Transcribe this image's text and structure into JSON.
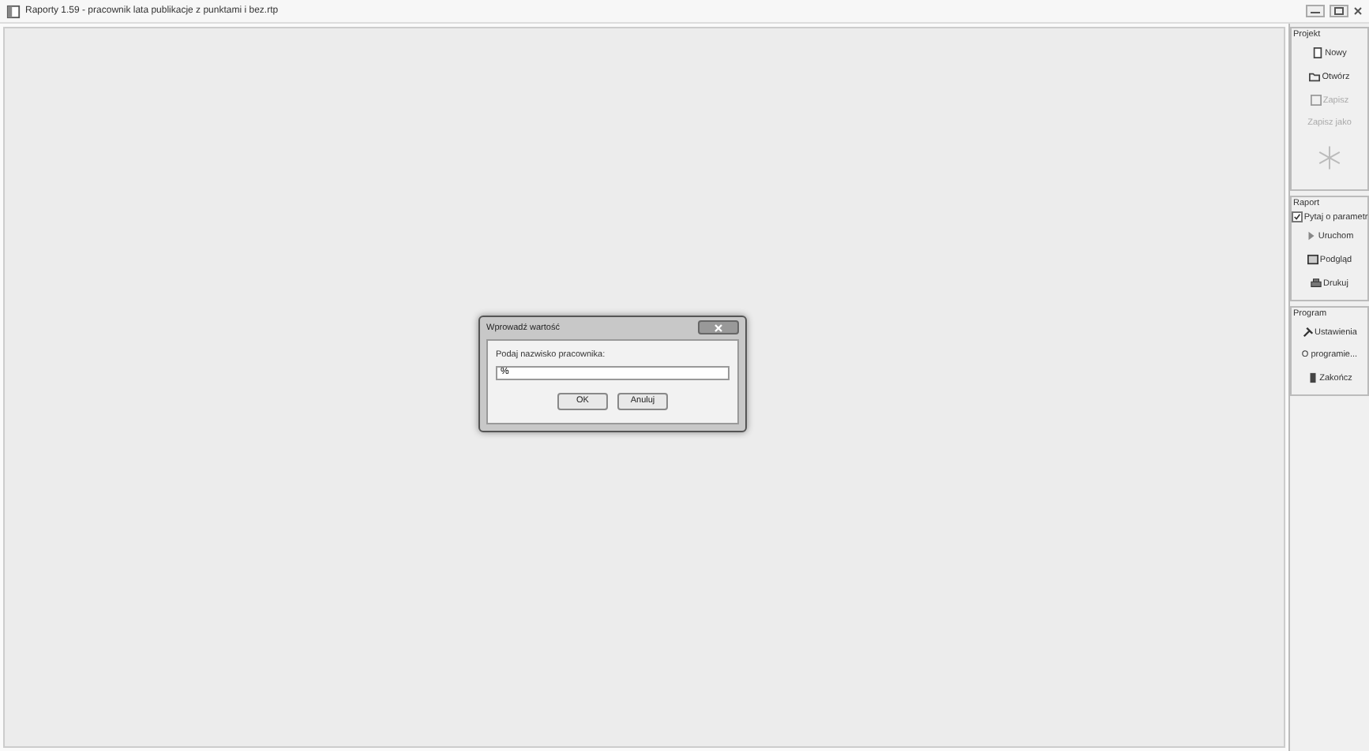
{
  "window": {
    "title": "Raporty 1.59  - pracownik lata publikacje z punktami i bez.rtp"
  },
  "sidebar": {
    "groups": [
      {
        "title": "Projekt",
        "items": [
          {
            "kind": "file",
            "label": "Nowy",
            "disabled": false
          },
          {
            "kind": "folder",
            "label": "Otwórz",
            "disabled": false
          },
          {
            "kind": "disk",
            "label": "Zapisz",
            "disabled": true
          },
          {
            "kind": "plain",
            "label": "Zapisz jako",
            "disabled": true
          },
          {
            "kind": "snowflake"
          }
        ]
      },
      {
        "title": "Raport",
        "items": [
          {
            "kind": "checkbox",
            "label": "Pytaj o parametr",
            "checked": true
          },
          {
            "kind": "play",
            "label": "Uruchom",
            "disabled": false
          },
          {
            "kind": "preview",
            "label": "Podgląd",
            "disabled": false
          },
          {
            "kind": "printer",
            "label": "Drukuj",
            "disabled": false
          }
        ]
      },
      {
        "title": "Program",
        "items": [
          {
            "kind": "tools",
            "label": "Ustawienia",
            "disabled": false
          },
          {
            "kind": "plain",
            "label": "O programie...",
            "disabled": false
          },
          {
            "kind": "exit",
            "label": "Zakończ",
            "disabled": false
          }
        ]
      }
    ]
  },
  "dialog": {
    "title": "Wprowadź wartość",
    "prompt": "Podaj nazwisko pracownika:",
    "value": "%",
    "buttons": [
      "OK",
      "Anuluj"
    ]
  }
}
